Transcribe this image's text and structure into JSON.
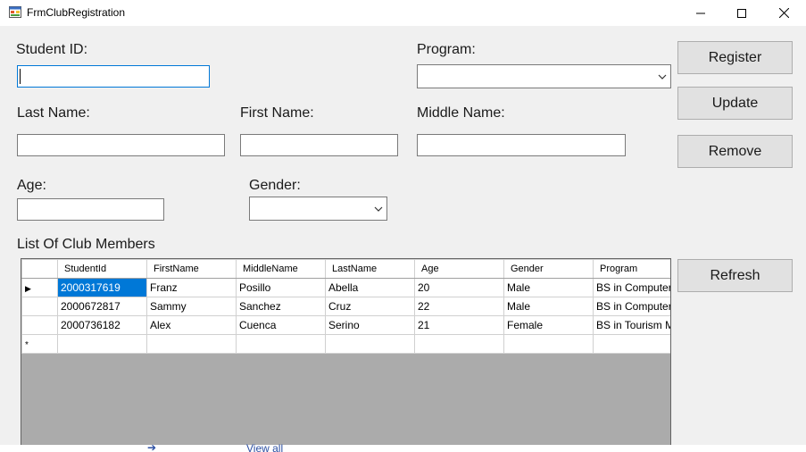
{
  "window": {
    "title": "FrmClubRegistration"
  },
  "form": {
    "student_id_label": "Student ID:",
    "student_id_value": "",
    "program_label": "Program:",
    "program_value": "",
    "last_name_label": "Last Name:",
    "last_name_value": "",
    "first_name_label": "First Name:",
    "first_name_value": "",
    "middle_name_label": "Middle Name:",
    "middle_name_value": "",
    "age_label": "Age:",
    "age_value": "",
    "gender_label": "Gender:",
    "gender_value": "",
    "list_label": "List Of Club Members"
  },
  "buttons": {
    "register": "Register",
    "update": "Update",
    "remove": "Remove",
    "refresh": "Refresh"
  },
  "grid": {
    "columns": [
      "StudentId",
      "FirstName",
      "MiddleName",
      "LastName",
      "Age",
      "Gender",
      "Program"
    ],
    "rows": [
      [
        "2000317619",
        "Franz",
        "Posillo",
        "Abella",
        "20",
        "Male",
        "BS in Computer S"
      ],
      [
        "2000672817",
        "Sammy",
        "Sanchez",
        "Cruz",
        "22",
        "Male",
        "BS in Computer S"
      ],
      [
        "2000736182",
        "Alex",
        "Cuenca",
        "Serino",
        "21",
        "Female",
        "BS in Tourism Ma"
      ]
    ],
    "current_row_glyph": "▶",
    "new_row_glyph": "*"
  },
  "background_app": {
    "link_text": "View all"
  },
  "colors": {
    "selection": "#0078d7",
    "focus_border": "#0078d7",
    "button_face": "#e1e1e1",
    "grid_empty": "#ababab"
  }
}
